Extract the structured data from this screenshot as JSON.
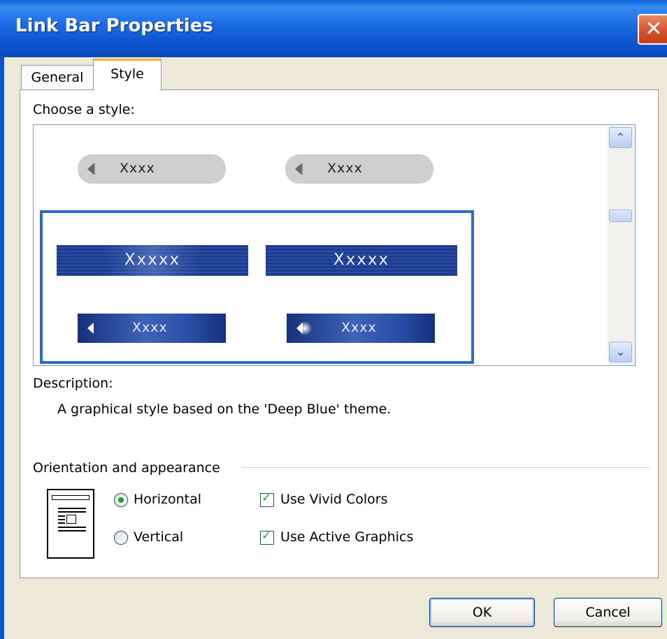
{
  "window": {
    "title": "Link Bar Properties",
    "close_glyph": "✕"
  },
  "tabs": [
    {
      "label": "General",
      "active": false
    },
    {
      "label": "Style",
      "active": true
    }
  ],
  "style_list": {
    "label": "Choose a style:",
    "pill_items": [
      {
        "label": "Xxxx"
      },
      {
        "label": "Xxxx"
      }
    ],
    "selected_theme": {
      "banners": [
        {
          "label": "Xxxxx"
        },
        {
          "label": "Xxxxx"
        }
      ],
      "buttons": [
        {
          "label": "Xxxx"
        },
        {
          "label": "Xxxx"
        }
      ]
    },
    "scroll_up_glyph": "⌃",
    "scroll_down_glyph": "⌄"
  },
  "description": {
    "label": "Description:",
    "text": "A graphical style based on the 'Deep Blue' theme."
  },
  "orientation": {
    "group_label": "Orientation and appearance",
    "options": [
      {
        "label": "Horizontal",
        "checked": true
      },
      {
        "label": "Vertical",
        "checked": false
      }
    ],
    "checkboxes": [
      {
        "label": "Use Vivid Colors",
        "checked": true
      },
      {
        "label": "Use Active Graphics",
        "checked": true
      }
    ],
    "check_glyph": "✓"
  },
  "buttons": {
    "ok": "OK",
    "cancel": "Cancel"
  },
  "colors": {
    "title_blue": "#0b55cf",
    "selection_blue": "#316ac5",
    "deep_blue": "#1d3b8e",
    "check_green": "#21a121"
  }
}
